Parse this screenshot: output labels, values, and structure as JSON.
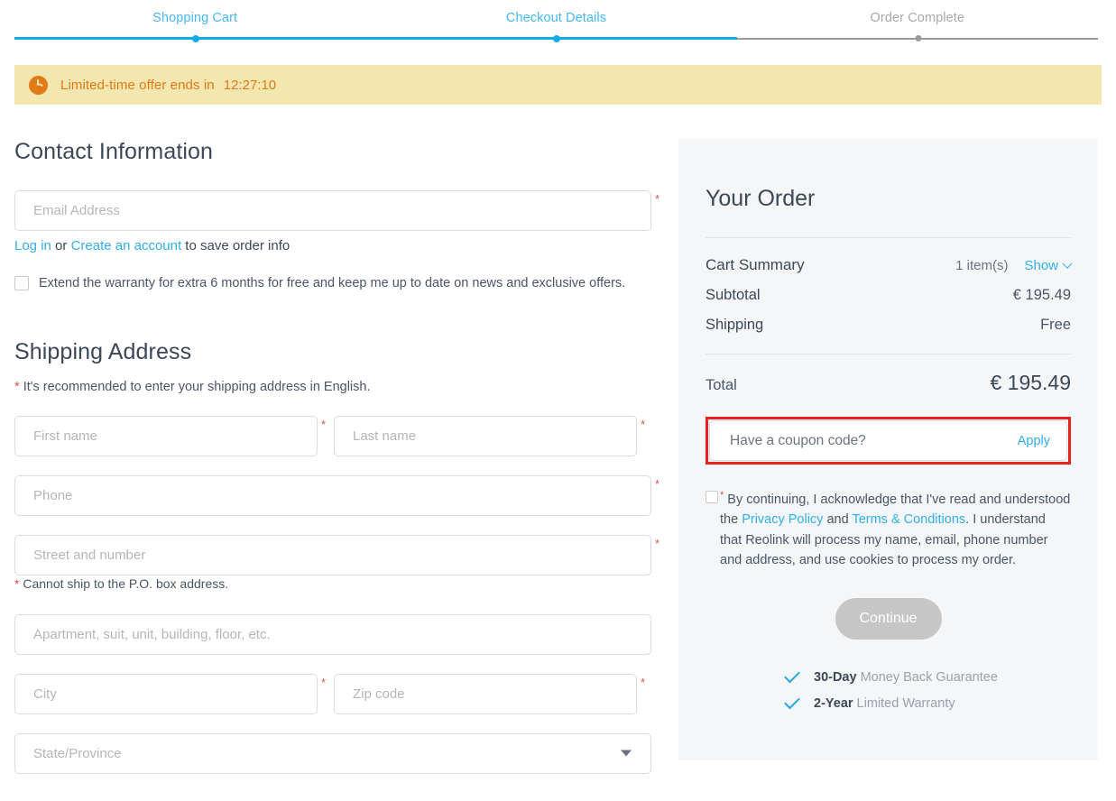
{
  "stepper": {
    "steps": [
      {
        "label": "Shopping Cart",
        "state": "done"
      },
      {
        "label": "Checkout Details",
        "state": "current"
      },
      {
        "label": "Order Complete",
        "state": "pending"
      }
    ],
    "active_color": "#17a9e5",
    "inactive_color": "#9a9a9a"
  },
  "banner": {
    "icon": "clock-icon",
    "text": "Limited-time offer ends in",
    "time": "12:27:10",
    "bg_color": "#f3e6ae",
    "text_color": "#e07b18"
  },
  "contact": {
    "title": "Contact Information",
    "email_placeholder": "Email Address",
    "email_value": "",
    "required_marker": "*",
    "helper": {
      "login_label": "Log in",
      "or": " or ",
      "create_label": "Create an account",
      "suffix": " to save order info"
    },
    "warranty_checkbox_label": "Extend the warranty for extra 6 months for free and keep me up to date on news and exclusive offers.",
    "warranty_checked": false
  },
  "shipping": {
    "title": "Shipping Address",
    "note_star": "*",
    "note": "It's recommended to enter your shipping address in English.",
    "first_name_placeholder": "First name",
    "last_name_placeholder": "Last name",
    "phone_placeholder": "Phone",
    "street_placeholder": "Street and number",
    "po_box_star": "*",
    "po_box_note": "Cannot ship to the P.O. box address.",
    "apartment_placeholder": "Apartment, suit, unit, building, floor, etc.",
    "city_placeholder": "City",
    "zip_placeholder": "Zip code",
    "state_placeholder": "State/Province",
    "state_value": ""
  },
  "order": {
    "title": "Your Order",
    "cart_summary_label": "Cart Summary",
    "item_count": "1 item(s)",
    "show_label": "Show",
    "subtotal_label": "Subtotal",
    "subtotal_value": "€ 195.49",
    "shipping_label": "Shipping",
    "shipping_value": "Free",
    "total_label": "Total",
    "total_value": "€ 195.49",
    "coupon_placeholder": "Have a coupon code?",
    "coupon_value": "",
    "apply_label": "Apply",
    "highlight_color": "#e8231f",
    "terms": {
      "checked": false,
      "star": "*",
      "part1": " By continuing, I acknowledge that I've read and understood the ",
      "privacy_label": "Privacy Policy",
      "part2": " and ",
      "terms_label": "Terms & Conditions",
      "part3": ". I understand that Reolink will process my name, email, phone number and address, and use cookies to process my order."
    },
    "continue_label": "Continue",
    "guarantees": [
      {
        "strong": "30-Day",
        "rest": "Money Back Guarantee"
      },
      {
        "strong": "2-Year",
        "rest": "Limited Warranty"
      }
    ]
  }
}
